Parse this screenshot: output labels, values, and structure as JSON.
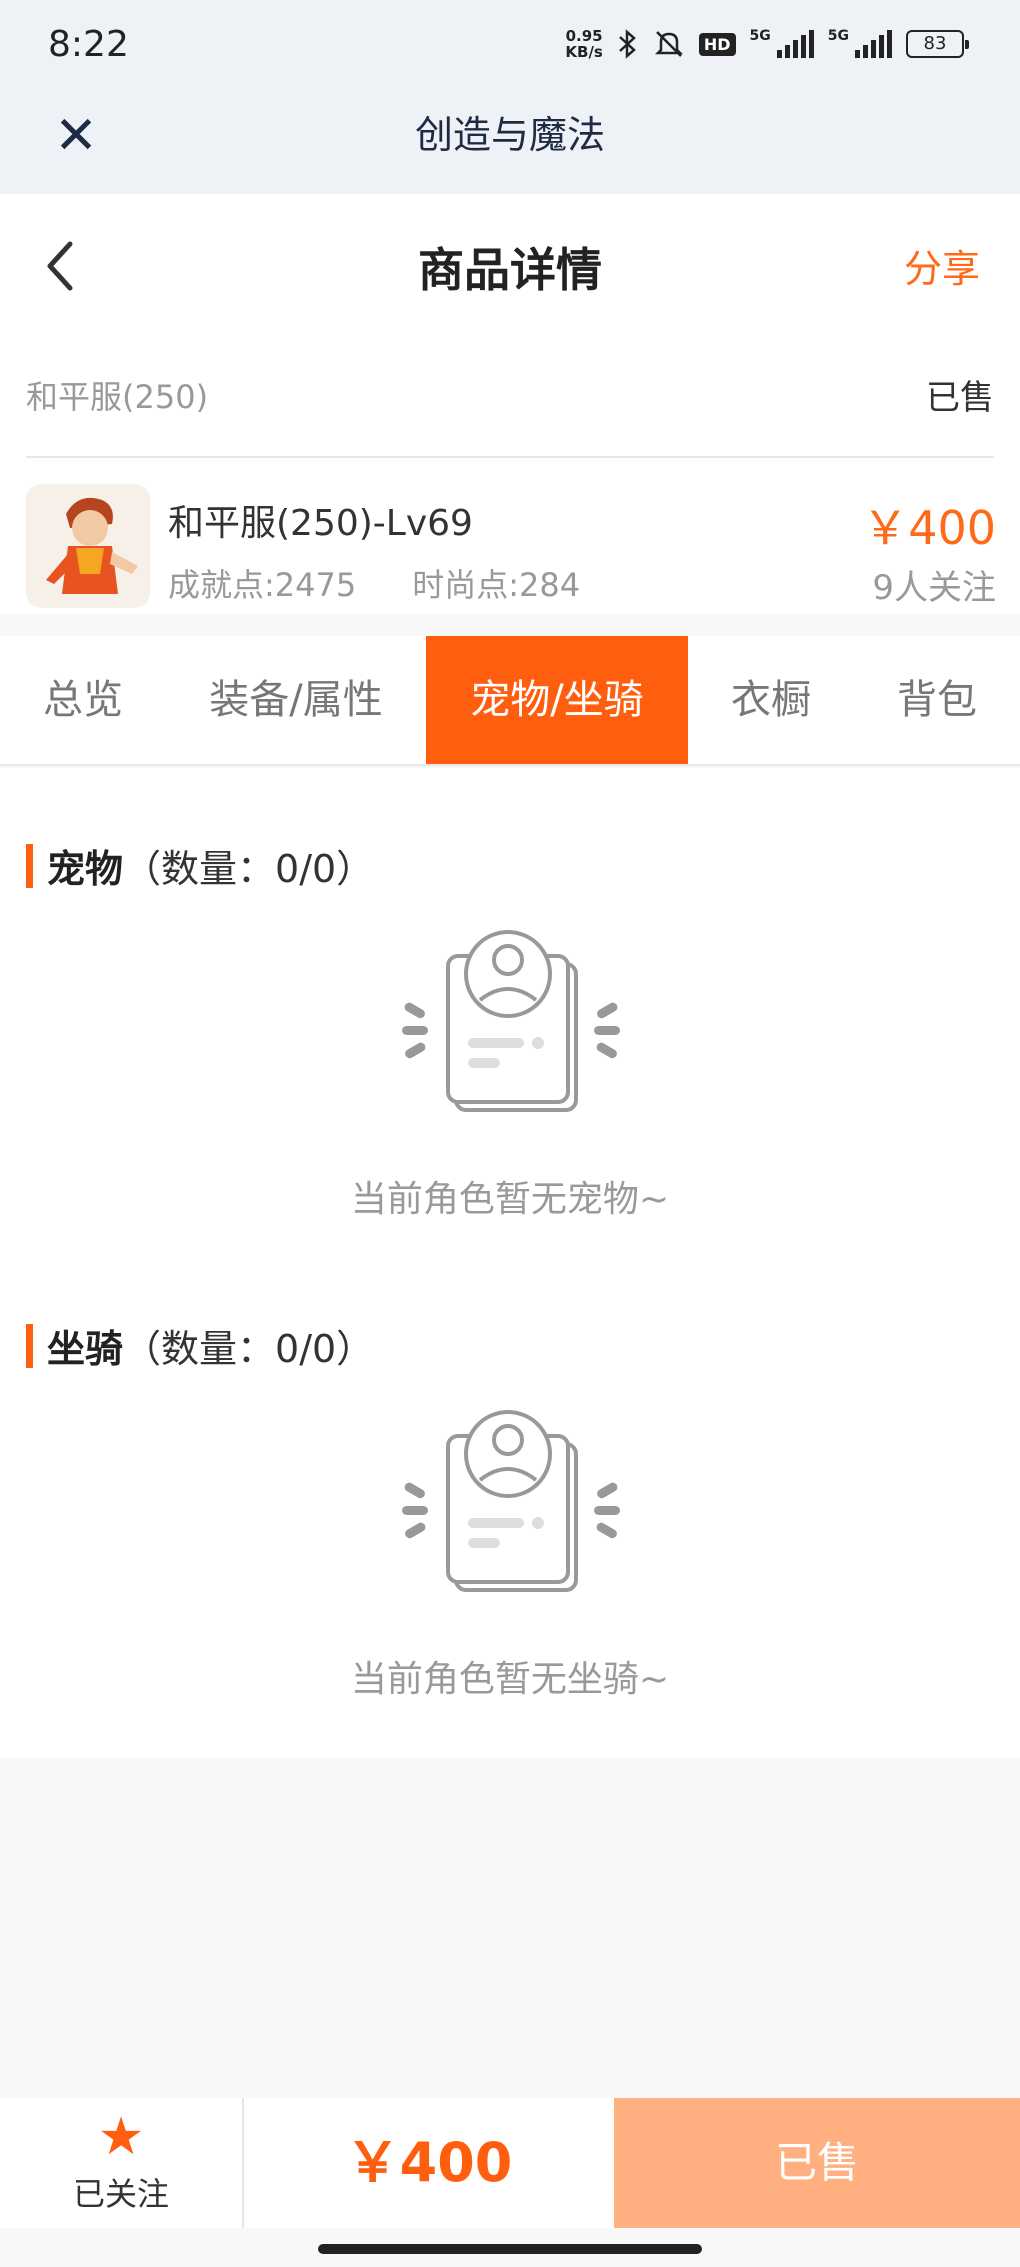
{
  "status_bar": {
    "time": "8:22",
    "net_speed_value": "0.95",
    "net_speed_unit": "KB/s",
    "hd_badge": "HD",
    "sim1_label": "5G",
    "sim2_label": "5G",
    "battery": "83"
  },
  "app_bar": {
    "close_icon": "✕",
    "title": "创造与魔法"
  },
  "header": {
    "back_icon": "‹",
    "title": "商品详情",
    "share_label": "分享"
  },
  "listing": {
    "server": "和平服(250)",
    "status": "已售",
    "item_title": "和平服(250)-Lv69",
    "achievement": "成就点:2475",
    "fashion": "时尚点:284",
    "price": "￥400",
    "followers": "9人关注"
  },
  "tabs": [
    {
      "label": "总览"
    },
    {
      "label": "装备/属性"
    },
    {
      "label": "宠物/坐骑"
    },
    {
      "label": "衣橱"
    },
    {
      "label": "背包"
    }
  ],
  "sections": {
    "pets": {
      "name": "宠物",
      "count": "（数量：0/0）",
      "empty_text": "当前角色暂无宠物~"
    },
    "mounts": {
      "name": "坐骑",
      "count": "（数量：0/0）",
      "empty_text": "当前角色暂无坐骑~"
    }
  },
  "bottom_bar": {
    "star_icon": "★",
    "follow_label": "已关注",
    "price": "￥400",
    "buy_label": "已售"
  },
  "colors": {
    "accent": "#ff5e0f",
    "accent_light": "#ffaf80",
    "muted_text": "#999999"
  }
}
